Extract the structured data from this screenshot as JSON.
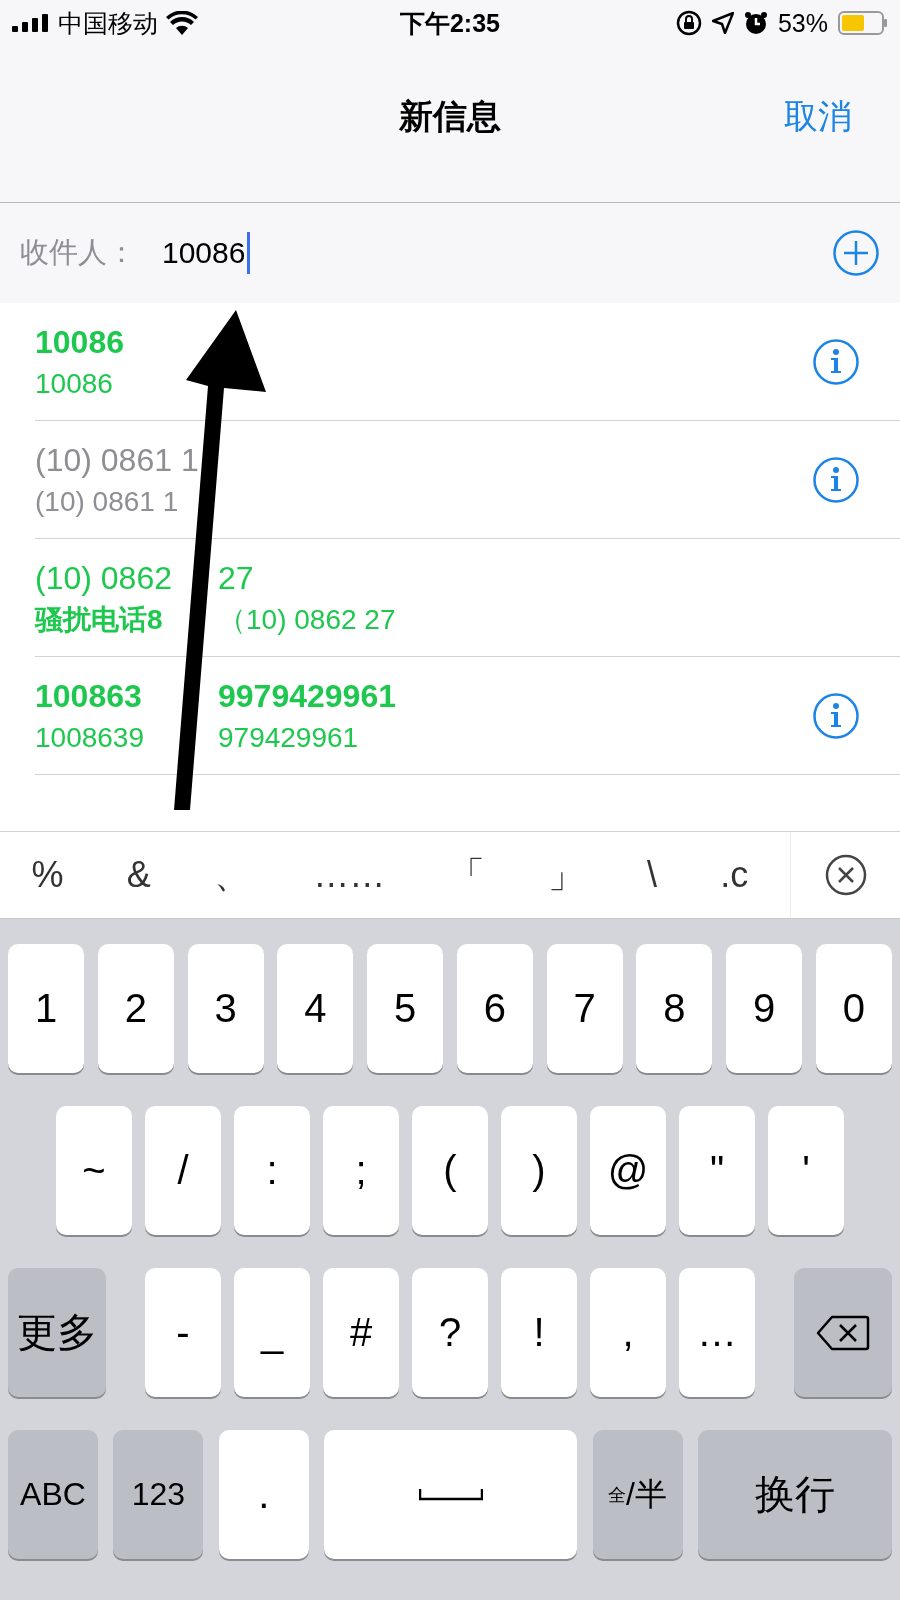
{
  "status_bar": {
    "carrier": "中国移动",
    "time": "下午2:35",
    "battery": "53%"
  },
  "nav": {
    "title": "新信息",
    "cancel": "取消"
  },
  "recipient": {
    "label": "收件人：",
    "value": "10086"
  },
  "suggestions": [
    {
      "title": [
        "10086"
      ],
      "subtitle": [
        {
          "text": "10086",
          "bold": false
        }
      ],
      "color": "#1ec84f",
      "bold": true,
      "info": true
    },
    {
      "title": [
        "(10) 0861 1"
      ],
      "subtitle": [
        {
          "text": "(10) 0861 1",
          "bold": false
        }
      ],
      "color": "#8e8e93",
      "bold": false,
      "info": true
    },
    {
      "title": [
        "(10) 0862",
        "27"
      ],
      "subtitle": [
        {
          "text": "骚扰电话8",
          "bold": true
        },
        {
          "text": "（10) 0862 27",
          "bold": false
        }
      ],
      "color": "#1ec84f",
      "bold": false,
      "info": false
    },
    {
      "title": [
        "100863",
        "9979429961"
      ],
      "subtitle": [
        {
          "text": "1008639",
          "bold": false
        },
        {
          "text": "979429961",
          "bold": false
        }
      ],
      "color": "#1ec84f",
      "bold": true,
      "info": true
    }
  ],
  "candidates": [
    "%",
    "&",
    "、",
    "……",
    "「",
    "」",
    "\\",
    ".c"
  ],
  "keyboard": {
    "rows": [
      {
        "keys": [
          {
            "kind": "char",
            "label": "1"
          },
          {
            "kind": "char",
            "label": "2"
          },
          {
            "kind": "char",
            "label": "3"
          },
          {
            "kind": "char",
            "label": "4"
          },
          {
            "kind": "char",
            "label": "5"
          },
          {
            "kind": "char",
            "label": "6"
          },
          {
            "kind": "char",
            "label": "7"
          },
          {
            "kind": "char",
            "label": "8"
          },
          {
            "kind": "char",
            "label": "9"
          },
          {
            "kind": "char",
            "label": "0"
          }
        ]
      },
      {
        "keys": [
          {
            "kind": "char",
            "label": "~"
          },
          {
            "kind": "char",
            "label": "/"
          },
          {
            "kind": "char",
            "label": ":"
          },
          {
            "kind": "char",
            "label": ";"
          },
          {
            "kind": "char",
            "label": "("
          },
          {
            "kind": "char",
            "label": ")"
          },
          {
            "kind": "char",
            "label": "@"
          },
          {
            "kind": "char",
            "label": "\""
          },
          {
            "kind": "char",
            "label": "'"
          }
        ]
      },
      {
        "keys": [
          {
            "kind": "function",
            "label": "更多"
          },
          {
            "kind": "char",
            "label": "-"
          },
          {
            "kind": "char",
            "label": "_"
          },
          {
            "kind": "char",
            "label": "#"
          },
          {
            "kind": "char",
            "label": "?"
          },
          {
            "kind": "char",
            "label": "!"
          },
          {
            "kind": "char",
            "label": ","
          },
          {
            "kind": "char",
            "label": "…"
          },
          {
            "kind": "backspace"
          }
        ]
      },
      {
        "keys": [
          {
            "kind": "function",
            "label": "ABC"
          },
          {
            "kind": "function",
            "label": "123"
          },
          {
            "kind": "char",
            "label": "."
          },
          {
            "kind": "space"
          },
          {
            "kind": "function",
            "label": "$^{全}$/半"
          },
          {
            "kind": "return",
            "label": "换行"
          }
        ]
      }
    ]
  }
}
